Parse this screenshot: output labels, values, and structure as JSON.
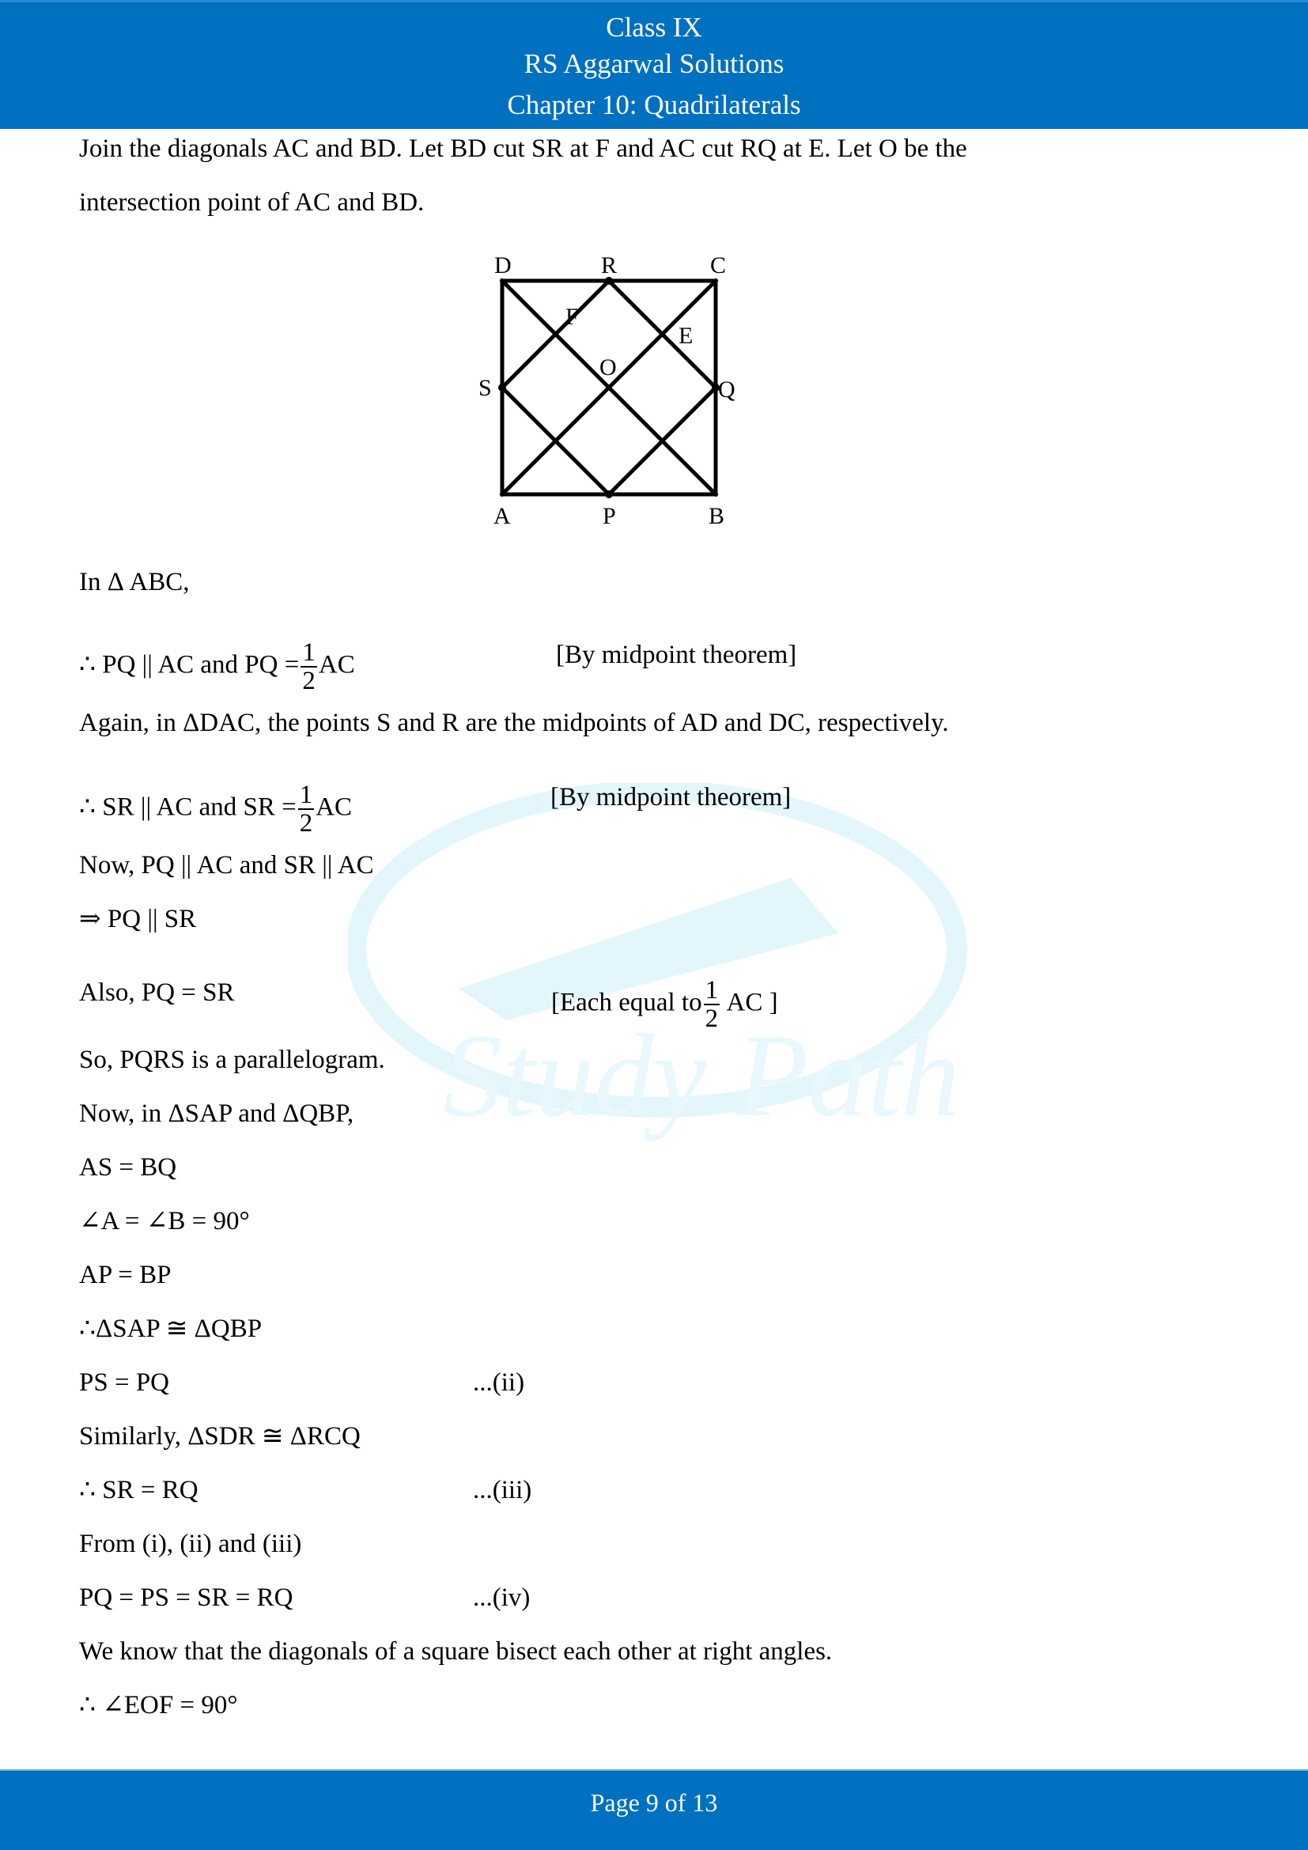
{
  "header": {
    "class": "Class IX",
    "book": "RS Aggarwal Solutions",
    "chapter": "Chapter 10: Quadrilaterals"
  },
  "intro": {
    "line1": "Join the diagonals AC and BD. Let BD cut SR at F and AC cut RQ at E. Let O be the",
    "line2": "intersection point of AC and BD."
  },
  "diagram": {
    "labels": {
      "D": "D",
      "R": "R",
      "C": "C",
      "F": "F",
      "E": "E",
      "O": "O",
      "S": "S",
      "Q": "Q",
      "A": "A",
      "P": "P",
      "B": "B"
    }
  },
  "steps": {
    "in_abc": "In Δ ABC,",
    "pq_pre": "∴ PQ || AC and PQ =",
    "pq_post": "AC",
    "reason1": "[By midpoint theorem]",
    "again": "Again, in ΔDAC, the points S and R are the midpoints of AD and DC, respectively.",
    "sr_pre": "∴  SR || AC and SR =",
    "sr_post": "AC",
    "reason2": "[By midpoint theorem]",
    "now_parallel": "Now, PQ || AC and SR || AC",
    "implies": "⇒ PQ || SR",
    "also": "Also, PQ  =  SR",
    "each_pre": "[Each equal to",
    "each_post": " AC ]",
    "frac_num": "1",
    "frac_den": "2",
    "parallelogram": "So, PQRS is a parallelogram.",
    "now_triangles": "Now, in ΔSAP and ΔQBP,",
    "as_bq": "AS = BQ",
    "angles": "∠A = ∠B = 90°",
    "ap_bp": "AP = BP",
    "congruent": "∴ΔSAP ≅ ΔQBP",
    "ps_pq": "PS = PQ",
    "ref_ii": "...(ii)",
    "similarly": "Similarly, ΔSDR ≅ ΔRCQ",
    "sr_rq": "∴ SR = RQ",
    "ref_iii": "...(iii)",
    "from": "From (i), (ii) and (iii)",
    "all_equal": "PQ = PS = SR = RQ",
    "ref_iv": "...(iv)",
    "know": "We know that the diagonals of a square bisect each other at right angles.",
    "eof": "∴ ∠EOF = 90°"
  },
  "watermark": {
    "text": "Study Path"
  },
  "footer": {
    "page_label": "Page 9 of 13",
    "current": 9,
    "total": 13
  },
  "colors": {
    "brand": "#0070c0",
    "watermark": "#e3f6fb"
  }
}
